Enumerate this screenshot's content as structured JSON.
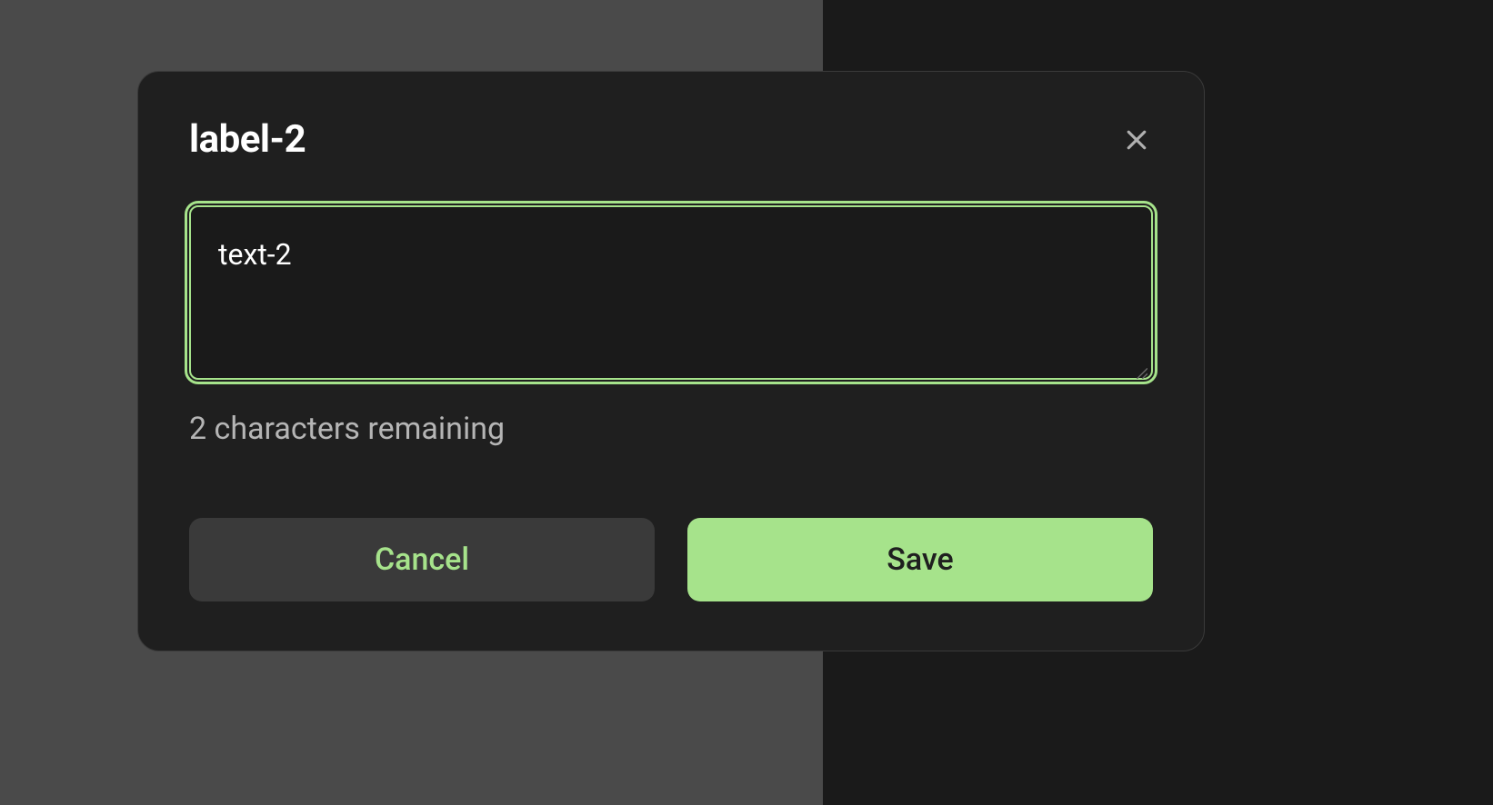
{
  "modal": {
    "title": "label-2",
    "textarea": {
      "value": "text-2"
    },
    "counter_text": "2 characters remaining",
    "buttons": {
      "cancel": "Cancel",
      "save": "Save"
    }
  },
  "colors": {
    "accent": "#a6e38b",
    "modal_bg": "#1f1f1f",
    "cancel_bg": "#3a3a3a"
  }
}
